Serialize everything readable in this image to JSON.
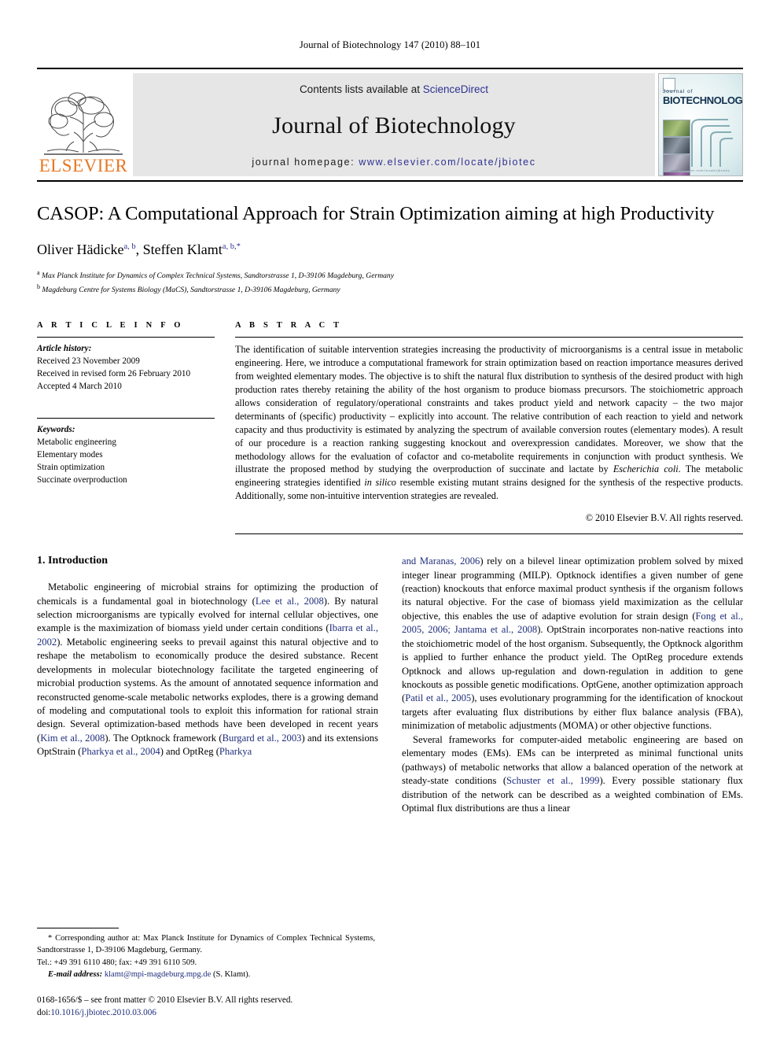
{
  "running_head": "Journal of Biotechnology 147 (2010) 88–101",
  "masthead": {
    "publisher_name": "ELSEVIER",
    "contents_prefix": "Contents lists available at ",
    "sciencedirect_label": "ScienceDirect",
    "journal_name": "Journal of Biotechnology",
    "homepage_prefix": "journal homepage:",
    "homepage_url": "www.elsevier.com/locate/jbiotec",
    "cover": {
      "small_title": "Journal of",
      "big_title": "BIOTECHNOLOGY",
      "footer": "www.elsevier.com/locate/jbiotec"
    },
    "link_color": "#2E3192"
  },
  "title": "CASOP: A Computational Approach for Strain Optimization aiming at high Productivity",
  "authors": {
    "author1_name": "Oliver Hädicke",
    "author1_sup": "a, b",
    "separator": ", ",
    "author2_name": "Steffen Klamt",
    "author2_sup": "a, b,*"
  },
  "affiliations": [
    {
      "marker": "a",
      "text": "Max Planck Institute for Dynamics of Complex Technical Systems, Sandtorstrasse 1, D-39106 Magdeburg, Germany"
    },
    {
      "marker": "b",
      "text": "Magdeburg Centre for Systems Biology (MaCS), Sandtorstrasse 1, D-39106 Magdeburg, Germany"
    }
  ],
  "article_info": {
    "label": "A R T I C L E    I N F O",
    "history_head": "Article history:",
    "history": [
      "Received 23 November 2009",
      "Received in revised form 26 February 2010",
      "Accepted 4 March 2010"
    ],
    "keywords_head": "Keywords:",
    "keywords": [
      "Metabolic engineering",
      "Elementary modes",
      "Strain optimization",
      "Succinate overproduction"
    ]
  },
  "abstract": {
    "label": "A B S T R A C T",
    "part1": "The identification of suitable intervention strategies increasing the productivity of microorganisms is a central issue in metabolic engineering. Here, we introduce a computational framework for strain optimization based on reaction importance measures derived from weighted elementary modes. The objective is to shift the natural flux distribution to synthesis of the desired product with high production rates thereby retaining the ability of the host organism to produce biomass precursors. The stoichiometric approach allows consideration of regulatory/operational constraints and takes product yield and network capacity – the two major determinants of (specific) productivity – explicitly into account. The relative contribution of each reaction to yield and network capacity and thus productivity is estimated by analyzing the spectrum of available conversion routes (elementary modes). A result of our procedure is a reaction ranking suggesting knockout and overexpression candidates. Moreover, we show that the methodology allows for the evaluation of cofactor and co-metabolite requirements in conjunction with product synthesis. We illustrate the proposed method by studying the overproduction of succinate and lactate by ",
    "italic1": "Escherichia coli",
    "part2": ". The metabolic engineering strategies identified ",
    "italic2": "in silico",
    "part3": " resemble existing mutant strains designed for the synthesis of the respective products. Additionally, some non-intuitive intervention strategies are revealed.",
    "copyright": "© 2010 Elsevier B.V. All rights reserved."
  },
  "body": {
    "section_heading": "1. Introduction",
    "left_p1": {
      "s1": "Metabolic engineering of microbial strains for optimizing the production of chemicals is a fundamental goal in biotechnology (",
      "c1": "Lee et al., 2008",
      "s2": "). By natural selection microorganisms are typically evolved for internal cellular objectives, one example is the maximization of biomass yield under certain conditions (",
      "c2": "Ibarra et al., 2002",
      "s3": "). Metabolic engineering seeks to prevail against this natural objective and to reshape the metabolism to economically produce the desired substance. Recent developments in molecular biotechnology facilitate the targeted engineering of microbial production systems. As the amount of annotated sequence information and reconstructed genome-scale metabolic networks explodes, there is a growing demand of modeling and computational tools to exploit this information for rational strain design. Several optimization-based methods have been developed in recent years (",
      "c3": "Kim et al., 2008",
      "s4": "). The Optknock framework (",
      "c4": "Burgard et al., 2003",
      "s5": ") and its extensions OptStrain (",
      "c5": "Pharkya et al., 2004",
      "s6": ") and OptReg (",
      "c6": "Pharkya"
    },
    "right_p1": {
      "c0": "and Maranas, 2006",
      "s1": ") rely on a bilevel linear optimization problem solved by mixed integer linear programming (MILP). Optknock identifies a given number of gene (reaction) knockouts that enforce maximal product synthesis if the organism follows its natural objective. For the case of biomass yield maximization as the cellular objective, this enables the use of adaptive evolution for strain design (",
      "c1": "Fong et al., 2005, 2006; Jantama et al., 2008",
      "s2": "). OptStrain incorporates non-native reactions into the stoichiometric model of the host organism. Subsequently, the Optknock algorithm is applied to further enhance the product yield. The OptReg procedure extends Optknock and allows up-regulation and down-regulation in addition to gene knockouts as possible genetic modifications. OptGene, another optimization approach (",
      "c2": "Patil et al., 2005",
      "s3": "), uses evolutionary programming for the identification of knockout targets after evaluating flux distributions by either flux balance analysis (FBA), minimization of metabolic adjustments (MOMA) or other objective functions."
    },
    "right_p2": {
      "s1": "Several frameworks for computer-aided metabolic engineering are based on elementary modes (EMs). EMs can be interpreted as minimal functional units (pathways) of metabolic networks that allow a balanced operation of the network at steady-state conditions (",
      "c1": "Schuster et al., 1999",
      "s2": "). Every possible stationary flux distribution of the network can be described as a weighted combination of EMs. Optimal flux distributions are thus a linear"
    }
  },
  "footnotes": {
    "corresponding": "* Corresponding author at: Max Planck Institute for Dynamics of Complex Technical Systems, Sandtorstrasse 1, D-39106 Magdeburg, Germany.",
    "tel": "Tel.: +49 391 6110 480; fax: +49 391 6110 509.",
    "email_label": "E-mail address:",
    "email": "klamt@mpi-magdeburg.mpg.de",
    "email_suffix": " (S. Klamt).",
    "issn_line": "0168-1656/$ – see front matter © 2010 Elsevier B.V. All rights reserved.",
    "doi_label": "doi:",
    "doi_value": "10.1016/j.jbiotec.2010.03.006"
  }
}
